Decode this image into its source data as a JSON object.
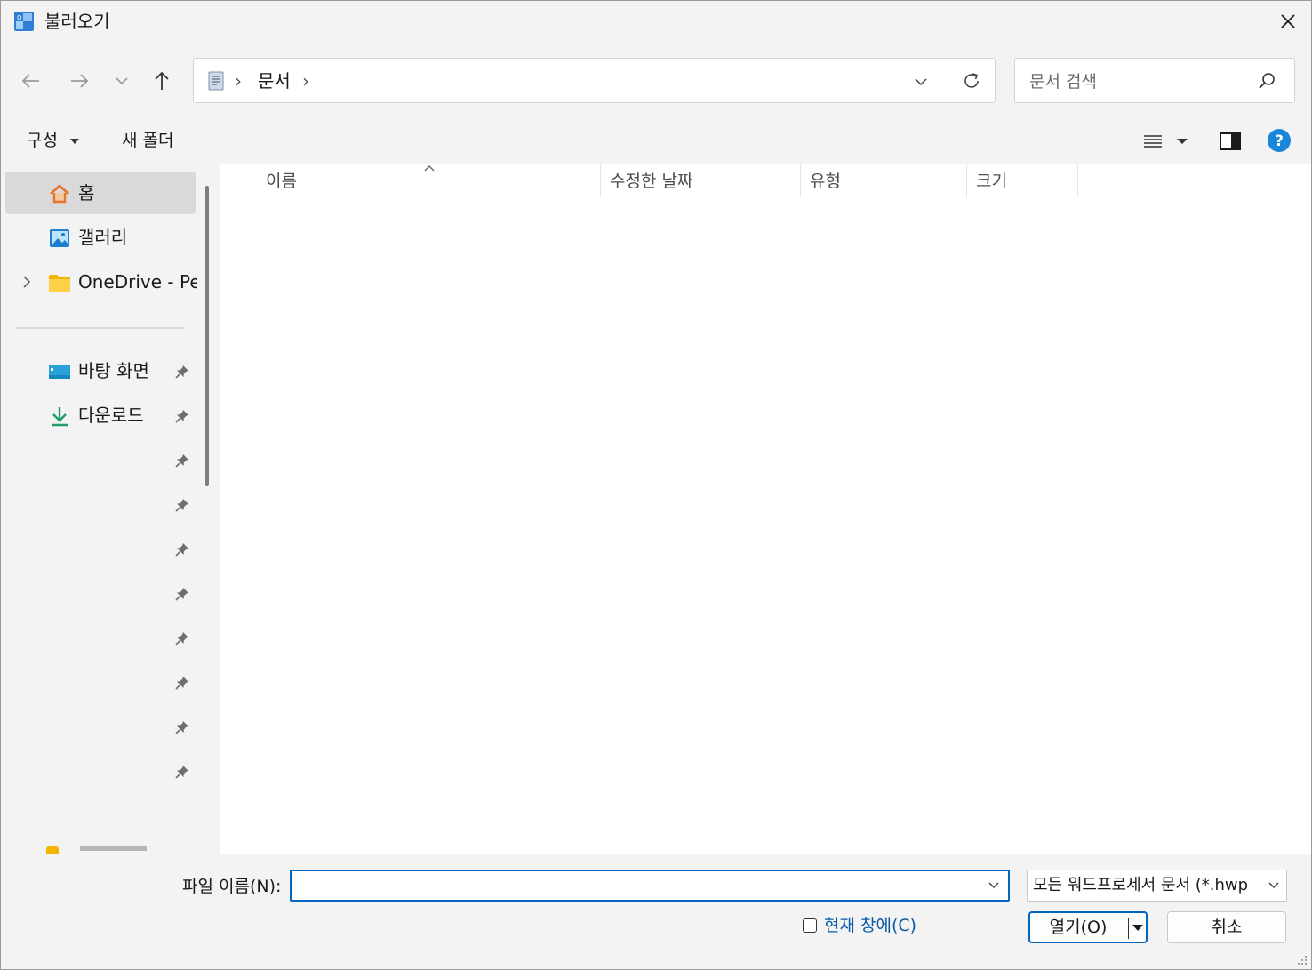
{
  "window": {
    "title": "불러오기"
  },
  "address": {
    "crumbs": [
      "문서"
    ]
  },
  "search": {
    "placeholder": "문서 검색"
  },
  "toolbar": {
    "organize_label": "구성",
    "new_folder_label": "새 폴더"
  },
  "sidebar": {
    "items": [
      {
        "label": "홈",
        "icon": "home-icon",
        "selected": true
      },
      {
        "label": "갤러리",
        "icon": "gallery-icon"
      },
      {
        "label": "OneDrive - Pers",
        "icon": "folder-icon",
        "expandable": true
      },
      {
        "label": "바탕 화면",
        "icon": "desktop-icon",
        "pinned": true
      },
      {
        "label": "다운로드",
        "icon": "download-icon",
        "pinned": true
      }
    ]
  },
  "columns": [
    "이름",
    "수정한 날짜",
    "유형",
    "크기"
  ],
  "bottom": {
    "file_name_label": "파일 이름(N):",
    "file_name_value": "",
    "filter_value": "모든 워드프로세서 문서 (*.hwp",
    "current_window_label": "현재 창에(C)",
    "open_label": "열기(O)",
    "cancel_label": "취소"
  },
  "colors": {
    "accent": "#0067c0",
    "folder": "#f0b500",
    "home": "#e8742a"
  }
}
